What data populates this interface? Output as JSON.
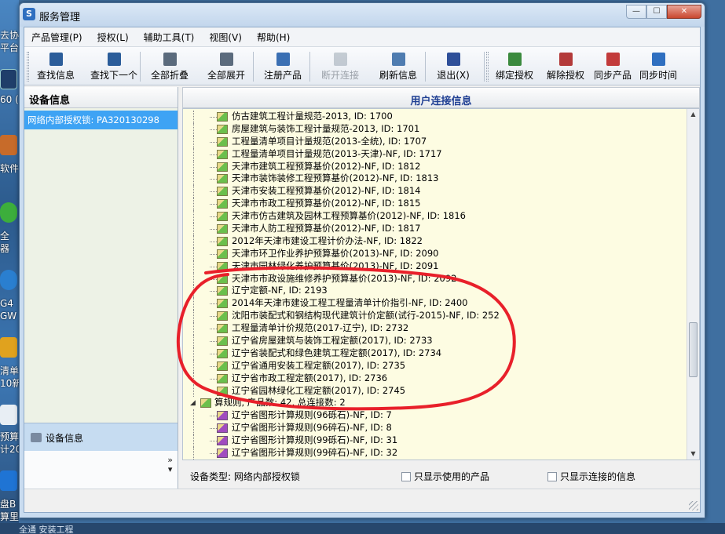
{
  "window": {
    "title": "服务管理"
  },
  "menu": [
    "产品管理(P)",
    "授权(L)",
    "辅助工具(T)",
    "视图(V)",
    "帮助(H)"
  ],
  "toolbar": [
    {
      "label": "查找信息",
      "icon": "binoculars-icon",
      "color": "#2b5d9a",
      "disabled": false
    },
    {
      "label": "查找下一个",
      "icon": "binoculars-next-icon",
      "color": "#2b5d9a",
      "disabled": false
    },
    {
      "label": "全部折叠",
      "icon": "collapse-all-icon",
      "color": "#5b6b7d",
      "disabled": false
    },
    {
      "label": "全部展开",
      "icon": "expand-all-icon",
      "color": "#5b6b7d",
      "disabled": false
    },
    {
      "label": "注册产品",
      "icon": "register-product-icon",
      "color": "#3a6fb3",
      "disabled": false
    },
    {
      "label": "断开连接",
      "icon": "disconnect-icon",
      "color": "#7b8a99",
      "disabled": true
    },
    {
      "label": "刷新信息",
      "icon": "refresh-icon",
      "color": "#4f7cb0",
      "disabled": false
    },
    {
      "label": "退出(X)",
      "icon": "exit-door-icon",
      "color": "#2e4f99",
      "disabled": false
    },
    {
      "label": "绑定授权",
      "icon": "bind-license-icon",
      "color": "#3b8a3e",
      "disabled": false
    },
    {
      "label": "解除授权",
      "icon": "unbind-license-icon",
      "color": "#b33a3a",
      "disabled": false
    },
    {
      "label": "同步产品",
      "icon": "sync-product-icon",
      "color": "#c23b3b",
      "disabled": false
    },
    {
      "label": "同步时间",
      "icon": "sync-time-icon",
      "color": "#2f6fc0",
      "disabled": false
    }
  ],
  "left": {
    "header": "设备信息",
    "device": "网络内部授权锁: PA320130298",
    "bottom_label": "设备信息"
  },
  "right": {
    "header": "用户连接信息",
    "tree": [
      {
        "text": "仿古建筑工程计量规范-2013, ID: 1700",
        "kind": "green"
      },
      {
        "text": "房屋建筑与装饰工程计量规范-2013, ID: 1701",
        "kind": "green"
      },
      {
        "text": "工程量清单项目计量规范(2013-全统), ID: 1707",
        "kind": "green"
      },
      {
        "text": "工程量清单项目计量规范(2013-天津)-NF, ID: 1717",
        "kind": "green"
      },
      {
        "text": "天津市建筑工程预算基价(2012)-NF, ID: 1812",
        "kind": "green"
      },
      {
        "text": "天津市装饰装修工程预算基价(2012)-NF, ID: 1813",
        "kind": "green"
      },
      {
        "text": "天津市安装工程预算基价(2012)-NF, ID: 1814",
        "kind": "green"
      },
      {
        "text": "天津市市政工程预算基价(2012)-NF, ID: 1815",
        "kind": "green"
      },
      {
        "text": "天津市仿古建筑及园林工程预算基价(2012)-NF, ID: 1816",
        "kind": "green"
      },
      {
        "text": "天津市人防工程预算基价(2012)-NF, ID: 1817",
        "kind": "green"
      },
      {
        "text": "2012年天津市建设工程计价办法-NF, ID: 1822",
        "kind": "green"
      },
      {
        "text": "天津市环卫作业养护预算基价(2013)-NF, ID: 2090",
        "kind": "green"
      },
      {
        "text": "天津市园林绿化养护预算基价(2013)-NF, ID: 2091",
        "kind": "green"
      },
      {
        "text": "天津市市政设施维修养护预算基价(2013)-NF, ID: 2092",
        "kind": "green"
      },
      {
        "text": "辽宁定额-NF, ID: 2193",
        "kind": "green"
      },
      {
        "text": "2014年天津市建设工程工程量清单计价指引-NF, ID: 2400",
        "kind": "green"
      },
      {
        "text": "沈阳市装配式和钢结构现代建筑计价定额(试行-2015)-NF, ID: 252",
        "kind": "green"
      },
      {
        "text": "工程量清单计价规范(2017-辽宁), ID: 2732",
        "kind": "green"
      },
      {
        "text": "辽宁省房屋建筑与装饰工程定额(2017), ID: 2733",
        "kind": "green"
      },
      {
        "text": "辽宁省装配式和绿色建筑工程定额(2017), ID: 2734",
        "kind": "green"
      },
      {
        "text": "辽宁省通用安装工程定额(2017), ID: 2735",
        "kind": "green"
      },
      {
        "text": "辽宁省市政工程定额(2017), ID: 2736",
        "kind": "green"
      },
      {
        "text": "辽宁省园林绿化工程定额(2017), ID: 2745",
        "kind": "green"
      },
      {
        "text": "算规则, 产品数: 42, 总连接数: 2",
        "kind": "parent"
      },
      {
        "text": "辽宁省图形计算规则(96砾石)-NF, ID: 7",
        "kind": "purple"
      },
      {
        "text": "辽宁省图形计算规则(96碎石)-NF, ID: 8",
        "kind": "purple"
      },
      {
        "text": "辽宁省图形计算规则(99砾石)-NF, ID: 31",
        "kind": "purple"
      },
      {
        "text": "辽宁省图形计算规则(99碎石)-NF, ID: 32",
        "kind": "purple"
      }
    ],
    "device_type_label": "设备类型: 网络内部授权锁",
    "check_used": "只显示使用的产品",
    "check_connected": "只显示连接的信息"
  },
  "desktop": {
    "fragments": [
      "去协",
      "平台",
      "60 (",
      "软件",
      "全",
      "器",
      "G4",
      "GW",
      "清单",
      "10新",
      "预算",
      "计20",
      "盘B",
      "算里"
    ],
    "bottom_text": "全通  安装工程"
  },
  "colors": {
    "tree_bg": "#fdfce2",
    "selected": "#3ea3f4",
    "annotation": "#e8202a"
  }
}
